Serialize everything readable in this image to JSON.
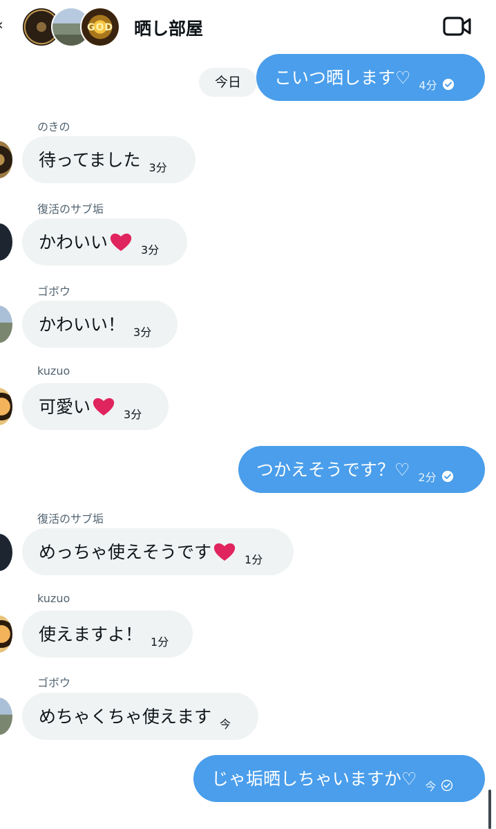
{
  "header": {
    "title": "晒し部屋",
    "avatar_text": "GOD",
    "video_icon": "video-camera-icon"
  },
  "date_separator": "今日",
  "messages": [
    {
      "direction": "out",
      "text": "こいつ晒します♡",
      "time": "4分",
      "status": "read"
    },
    {
      "direction": "in",
      "sender": "のきの",
      "text": "待ってました",
      "time": "3分"
    },
    {
      "direction": "in",
      "sender": "復活のサブ垢",
      "text": "かわいい",
      "emoji": "heart-emoji",
      "time": "3分"
    },
    {
      "direction": "in",
      "sender": "ゴボウ",
      "text": "かわいい！",
      "time": "3分"
    },
    {
      "direction": "in",
      "sender": "kuzuo",
      "text": "可愛い",
      "emoji": "heart-emoji",
      "time": "3分"
    },
    {
      "direction": "out",
      "text": "つかえそうです？♡",
      "time": "2分",
      "status": "read"
    },
    {
      "direction": "in",
      "sender": "復活のサブ垢",
      "text": "めっちゃ使えそうです",
      "emoji": "heart-emoji",
      "time": "1分"
    },
    {
      "direction": "in",
      "sender": "kuzuo",
      "text": "使えますよ！",
      "time": "1分"
    },
    {
      "direction": "in",
      "sender": "ゴボウ",
      "text": "めちゃくちゃ使えます",
      "time": "今"
    },
    {
      "direction": "out",
      "text": "じゃ垢晒しちゃいますか♡",
      "time": "今",
      "status": "sent"
    }
  ],
  "colors": {
    "outgoing_bubble": "#4a9eeb",
    "incoming_bubble": "#eff3f4",
    "sender_name": "#536471",
    "heart": "#e0245e"
  }
}
